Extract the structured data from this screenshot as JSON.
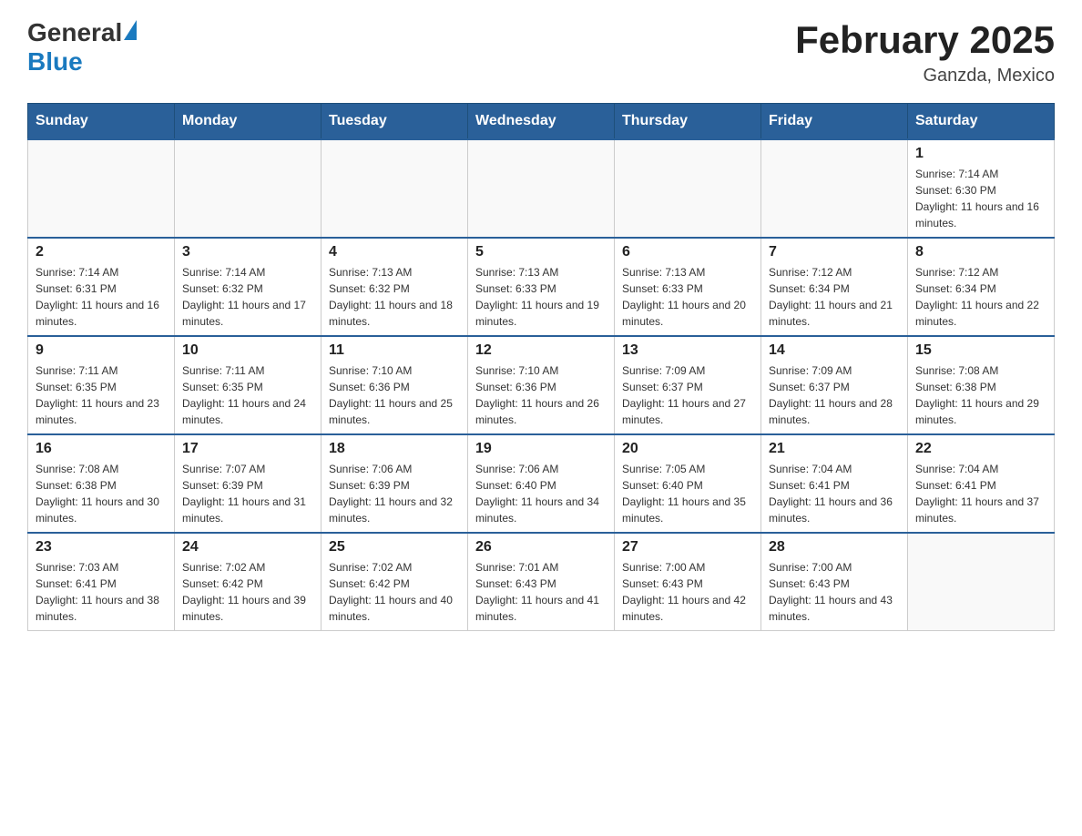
{
  "header": {
    "logo_general": "General",
    "logo_blue": "Blue",
    "title": "February 2025",
    "subtitle": "Ganzda, Mexico"
  },
  "days_of_week": [
    "Sunday",
    "Monday",
    "Tuesday",
    "Wednesday",
    "Thursday",
    "Friday",
    "Saturday"
  ],
  "weeks": [
    [
      {
        "day": "",
        "info": ""
      },
      {
        "day": "",
        "info": ""
      },
      {
        "day": "",
        "info": ""
      },
      {
        "day": "",
        "info": ""
      },
      {
        "day": "",
        "info": ""
      },
      {
        "day": "",
        "info": ""
      },
      {
        "day": "1",
        "info": "Sunrise: 7:14 AM\nSunset: 6:30 PM\nDaylight: 11 hours and 16 minutes."
      }
    ],
    [
      {
        "day": "2",
        "info": "Sunrise: 7:14 AM\nSunset: 6:31 PM\nDaylight: 11 hours and 16 minutes."
      },
      {
        "day": "3",
        "info": "Sunrise: 7:14 AM\nSunset: 6:32 PM\nDaylight: 11 hours and 17 minutes."
      },
      {
        "day": "4",
        "info": "Sunrise: 7:13 AM\nSunset: 6:32 PM\nDaylight: 11 hours and 18 minutes."
      },
      {
        "day": "5",
        "info": "Sunrise: 7:13 AM\nSunset: 6:33 PM\nDaylight: 11 hours and 19 minutes."
      },
      {
        "day": "6",
        "info": "Sunrise: 7:13 AM\nSunset: 6:33 PM\nDaylight: 11 hours and 20 minutes."
      },
      {
        "day": "7",
        "info": "Sunrise: 7:12 AM\nSunset: 6:34 PM\nDaylight: 11 hours and 21 minutes."
      },
      {
        "day": "8",
        "info": "Sunrise: 7:12 AM\nSunset: 6:34 PM\nDaylight: 11 hours and 22 minutes."
      }
    ],
    [
      {
        "day": "9",
        "info": "Sunrise: 7:11 AM\nSunset: 6:35 PM\nDaylight: 11 hours and 23 minutes."
      },
      {
        "day": "10",
        "info": "Sunrise: 7:11 AM\nSunset: 6:35 PM\nDaylight: 11 hours and 24 minutes."
      },
      {
        "day": "11",
        "info": "Sunrise: 7:10 AM\nSunset: 6:36 PM\nDaylight: 11 hours and 25 minutes."
      },
      {
        "day": "12",
        "info": "Sunrise: 7:10 AM\nSunset: 6:36 PM\nDaylight: 11 hours and 26 minutes."
      },
      {
        "day": "13",
        "info": "Sunrise: 7:09 AM\nSunset: 6:37 PM\nDaylight: 11 hours and 27 minutes."
      },
      {
        "day": "14",
        "info": "Sunrise: 7:09 AM\nSunset: 6:37 PM\nDaylight: 11 hours and 28 minutes."
      },
      {
        "day": "15",
        "info": "Sunrise: 7:08 AM\nSunset: 6:38 PM\nDaylight: 11 hours and 29 minutes."
      }
    ],
    [
      {
        "day": "16",
        "info": "Sunrise: 7:08 AM\nSunset: 6:38 PM\nDaylight: 11 hours and 30 minutes."
      },
      {
        "day": "17",
        "info": "Sunrise: 7:07 AM\nSunset: 6:39 PM\nDaylight: 11 hours and 31 minutes."
      },
      {
        "day": "18",
        "info": "Sunrise: 7:06 AM\nSunset: 6:39 PM\nDaylight: 11 hours and 32 minutes."
      },
      {
        "day": "19",
        "info": "Sunrise: 7:06 AM\nSunset: 6:40 PM\nDaylight: 11 hours and 34 minutes."
      },
      {
        "day": "20",
        "info": "Sunrise: 7:05 AM\nSunset: 6:40 PM\nDaylight: 11 hours and 35 minutes."
      },
      {
        "day": "21",
        "info": "Sunrise: 7:04 AM\nSunset: 6:41 PM\nDaylight: 11 hours and 36 minutes."
      },
      {
        "day": "22",
        "info": "Sunrise: 7:04 AM\nSunset: 6:41 PM\nDaylight: 11 hours and 37 minutes."
      }
    ],
    [
      {
        "day": "23",
        "info": "Sunrise: 7:03 AM\nSunset: 6:41 PM\nDaylight: 11 hours and 38 minutes."
      },
      {
        "day": "24",
        "info": "Sunrise: 7:02 AM\nSunset: 6:42 PM\nDaylight: 11 hours and 39 minutes."
      },
      {
        "day": "25",
        "info": "Sunrise: 7:02 AM\nSunset: 6:42 PM\nDaylight: 11 hours and 40 minutes."
      },
      {
        "day": "26",
        "info": "Sunrise: 7:01 AM\nSunset: 6:43 PM\nDaylight: 11 hours and 41 minutes."
      },
      {
        "day": "27",
        "info": "Sunrise: 7:00 AM\nSunset: 6:43 PM\nDaylight: 11 hours and 42 minutes."
      },
      {
        "day": "28",
        "info": "Sunrise: 7:00 AM\nSunset: 6:43 PM\nDaylight: 11 hours and 43 minutes."
      },
      {
        "day": "",
        "info": ""
      }
    ]
  ]
}
